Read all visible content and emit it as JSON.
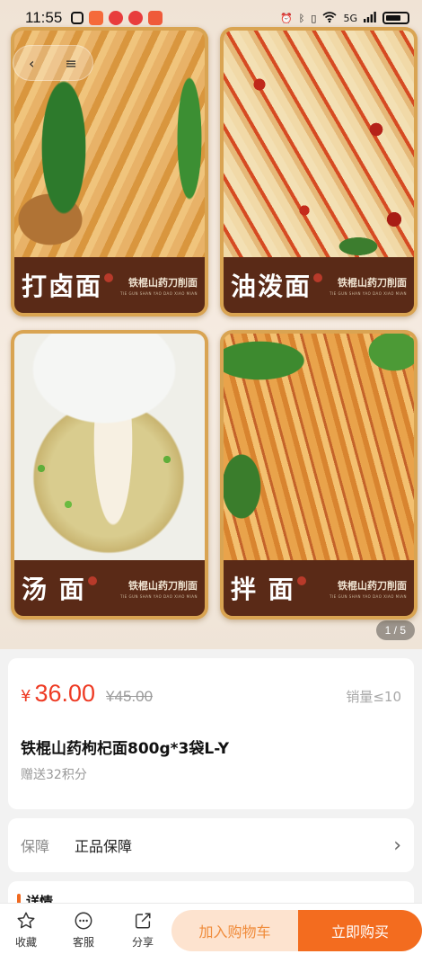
{
  "status_bar": {
    "time": "11:55",
    "network": "5G"
  },
  "gallery": {
    "counter": "1 / 5",
    "tiles": [
      {
        "dish": "打卤面",
        "brand_cn": "铁棍山药刀削面",
        "brand_en": "TIE GUN SHAN YAO DAO XIAO MIAN"
      },
      {
        "dish": "油泼面",
        "brand_cn": "铁棍山药刀削面",
        "brand_en": "TIE GUN SHAN YAO DAO XIAO MIAN"
      },
      {
        "dish": "汤 面",
        "brand_cn": "铁棍山药刀削面",
        "brand_en": "TIE GUN SHAN YAO DAO XIAO MIAN"
      },
      {
        "dish": "拌 面",
        "brand_cn": "铁棍山药刀削面",
        "brand_en": "TIE GUN SHAN YAO DAO XIAO MIAN"
      }
    ]
  },
  "product": {
    "currency": "¥",
    "price": "36.00",
    "original_price": "¥45.00",
    "sales": "销量≤10",
    "title": "铁棍山药枸杞面800g*3袋L-Y",
    "points": "赠送32积分"
  },
  "guarantee": {
    "label": "保障",
    "value": "正品保障"
  },
  "details": {
    "title": "详情"
  },
  "bottom_bar": {
    "favorite": "收藏",
    "service": "客服",
    "share": "分享",
    "add_to_cart": "加入购物车",
    "buy_now": "立即购买"
  },
  "colors": {
    "accent": "#f36c1f",
    "price": "#ee3b24",
    "cart_bg": "#fde3cf",
    "banner": "#5a2a17"
  }
}
